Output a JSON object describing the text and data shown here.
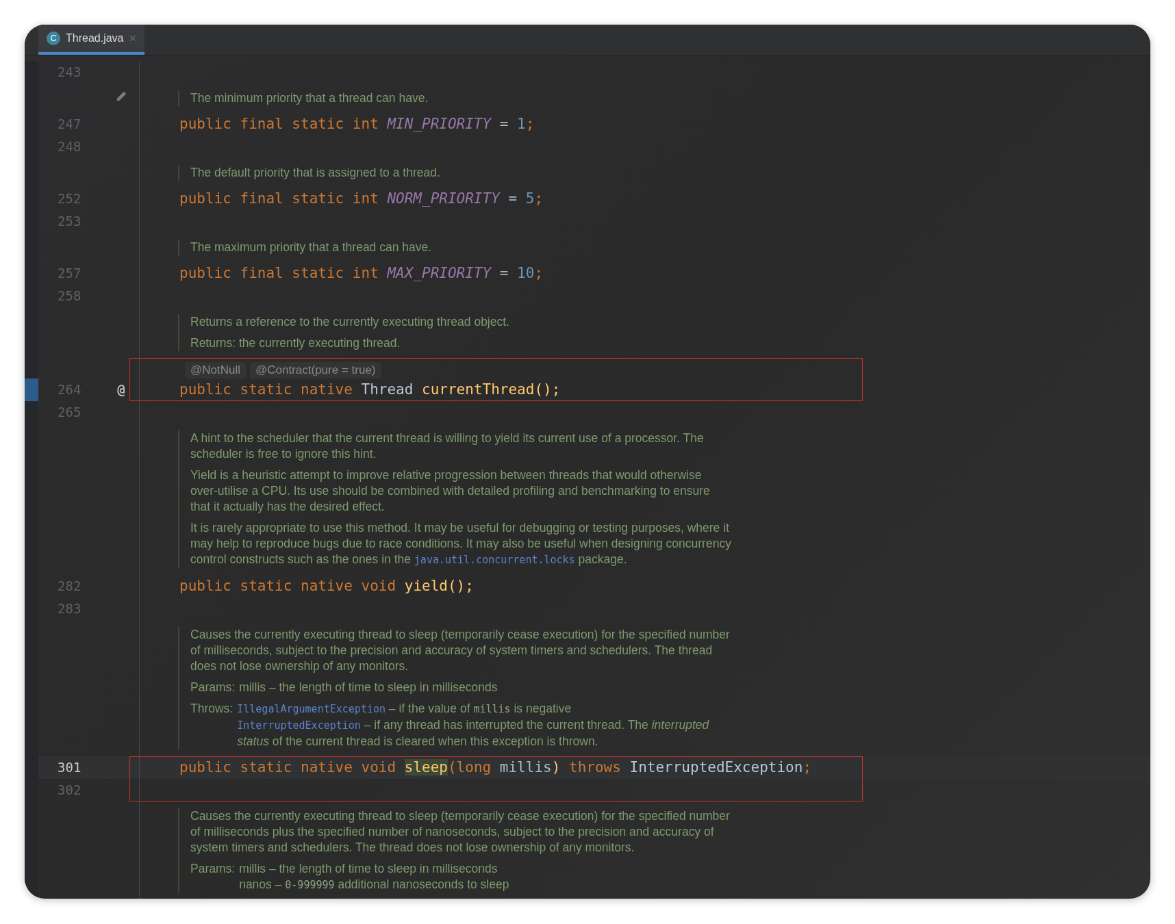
{
  "tabs": [
    {
      "label": "Thread.java",
      "icon": "C",
      "selected": true,
      "close": "×"
    }
  ],
  "rows": [
    {
      "kind": "code",
      "number": "243",
      "tokens": []
    },
    {
      "kind": "doc",
      "pencil": true,
      "paragraphs": [
        {
          "kind": "text",
          "segments": [
            {
              "kind": "text",
              "text": "The minimum priority that a thread can have."
            }
          ]
        }
      ]
    },
    {
      "kind": "code",
      "number": "247",
      "tokens": [
        {
          "kind": "keyword",
          "text": "public final static int "
        },
        {
          "kind": "constant",
          "text": "MIN_PRIORITY"
        },
        {
          "kind": "plain",
          "text": " = "
        },
        {
          "kind": "number",
          "text": "1"
        },
        {
          "kind": "keyword",
          "text": ";"
        }
      ]
    },
    {
      "kind": "code",
      "number": "248",
      "tokens": []
    },
    {
      "kind": "doc",
      "paragraphs": [
        {
          "kind": "text",
          "segments": [
            {
              "kind": "text",
              "text": "The default priority that is assigned to a thread."
            }
          ]
        }
      ]
    },
    {
      "kind": "code",
      "number": "252",
      "tokens": [
        {
          "kind": "keyword",
          "text": "public final static int "
        },
        {
          "kind": "constant",
          "text": "NORM_PRIORITY"
        },
        {
          "kind": "plain",
          "text": " = "
        },
        {
          "kind": "number",
          "text": "5"
        },
        {
          "kind": "keyword",
          "text": ";"
        }
      ]
    },
    {
      "kind": "code",
      "number": "253",
      "tokens": []
    },
    {
      "kind": "doc",
      "paragraphs": [
        {
          "kind": "text",
          "segments": [
            {
              "kind": "text",
              "text": "The maximum priority that a thread can have."
            }
          ]
        }
      ]
    },
    {
      "kind": "code",
      "number": "257",
      "tokens": [
        {
          "kind": "keyword",
          "text": "public final static int "
        },
        {
          "kind": "constant",
          "text": "MAX_PRIORITY"
        },
        {
          "kind": "plain",
          "text": " = "
        },
        {
          "kind": "number",
          "text": "10"
        },
        {
          "kind": "keyword",
          "text": ";"
        }
      ]
    },
    {
      "kind": "code",
      "number": "258",
      "tokens": []
    },
    {
      "kind": "doc",
      "paragraphs": [
        {
          "kind": "text",
          "segments": [
            {
              "kind": "text",
              "text": "Returns a reference to the currently executing thread object."
            }
          ]
        },
        {
          "kind": "text",
          "segments": [
            {
              "kind": "text",
              "text": "Returns: the currently executing thread."
            }
          ]
        }
      ]
    },
    {
      "kind": "box",
      "rows": [
        {
          "kind": "annotations",
          "items": [
            "@NotNull",
            "@Contract(pure = true)"
          ]
        },
        {
          "kind": "code",
          "number": "264",
          "marked": true,
          "gutter_mark": "@",
          "tokens": [
            {
              "kind": "keyword",
              "text": "public static native "
            },
            {
              "kind": "class",
              "text": "Thread"
            },
            {
              "kind": "method",
              "text": " currentThread();"
            }
          ]
        }
      ]
    },
    {
      "kind": "code",
      "number": "265",
      "tokens": []
    },
    {
      "kind": "doc",
      "paragraphs": [
        {
          "kind": "text",
          "segments": [
            {
              "kind": "text",
              "text": "A hint to the scheduler that the current thread is willing to yield its current use of a processor. The scheduler is free to ignore this hint."
            }
          ]
        },
        {
          "kind": "text",
          "segments": [
            {
              "kind": "text",
              "text": "Yield is a heuristic attempt to improve relative progression between threads that would otherwise over-utilise a CPU. Its use should be combined with detailed profiling and benchmarking to ensure that it actually has the desired effect."
            }
          ]
        },
        {
          "kind": "text",
          "segments": [
            {
              "kind": "text",
              "text": "It is rarely appropriate to use this method. It may be useful for debugging or testing purposes, where it may help to reproduce bugs due to race conditions. It may also be useful when designing concurrency control constructs such as the ones in the "
            },
            {
              "kind": "link",
              "text": "java.util.concurrent.locks"
            },
            {
              "kind": "text",
              "text": " package."
            }
          ]
        }
      ]
    },
    {
      "kind": "code",
      "number": "282",
      "tokens": [
        {
          "kind": "keyword",
          "text": "public static native void "
        },
        {
          "kind": "method",
          "text": "yield();"
        }
      ]
    },
    {
      "kind": "code",
      "number": "283",
      "tokens": []
    },
    {
      "kind": "doc",
      "paragraphs": [
        {
          "kind": "text",
          "segments": [
            {
              "kind": "text",
              "text": "Causes the currently executing thread to sleep (temporarily cease execution) for the specified number of milliseconds, subject to the precision and accuracy of system timers and schedulers. The thread does not lose ownership of any monitors."
            }
          ]
        },
        {
          "kind": "tagged",
          "label": "Params:",
          "items": [
            [
              {
                "kind": "text",
                "text": "millis – the length of time to sleep in milliseconds"
              }
            ]
          ]
        },
        {
          "kind": "tagged",
          "label": "Throws:",
          "items": [
            [
              {
                "kind": "link",
                "text": "IllegalArgumentException"
              },
              {
                "kind": "text",
                "text": " – if the value of "
              },
              {
                "kind": "code",
                "text": "millis"
              },
              {
                "kind": "text",
                "text": " is negative"
              }
            ],
            [
              {
                "kind": "link",
                "text": "InterruptedException"
              },
              {
                "kind": "text",
                "text": " – if any thread has interrupted the current thread. The *interrupted status* of the current thread is cleared when this exception is thrown."
              }
            ]
          ]
        }
      ]
    },
    {
      "kind": "box",
      "rows": [
        {
          "kind": "code",
          "number": "301",
          "current": true,
          "tokens": [
            {
              "kind": "keyword",
              "text": "public static native void "
            },
            {
              "kind": "method",
              "text": "sleep",
              "highlighted": true
            },
            {
              "kind": "keyword",
              "text": "("
            },
            {
              "kind": "keyword",
              "text": "long "
            },
            {
              "kind": "plain",
              "text": "millis"
            },
            {
              "kind": "method",
              "text": ")"
            },
            {
              "kind": "keyword",
              "text": " throws "
            },
            {
              "kind": "class",
              "text": "InterruptedException"
            },
            {
              "kind": "keyword",
              "text": ";"
            }
          ]
        },
        {
          "kind": "code",
          "number": "302",
          "tokens": []
        }
      ]
    },
    {
      "kind": "doc",
      "paragraphs": [
        {
          "kind": "text",
          "segments": [
            {
              "kind": "text",
              "text": "Causes the currently executing thread to sleep (temporarily cease execution) for the specified number of milliseconds plus the specified number of nanoseconds, subject to the precision and accuracy of system timers and schedulers. The thread does not lose ownership of any monitors."
            }
          ]
        },
        {
          "kind": "tagged",
          "label": "Params:",
          "items": [
            [
              {
                "kind": "text",
                "text": "millis – the length of time to sleep in milliseconds"
              }
            ],
            [
              {
                "kind": "text",
                "text": "nanos – "
              },
              {
                "kind": "code",
                "text": "0-999999"
              },
              {
                "kind": "text",
                "text": " additional nanoseconds to sleep"
              }
            ]
          ]
        }
      ]
    }
  ]
}
